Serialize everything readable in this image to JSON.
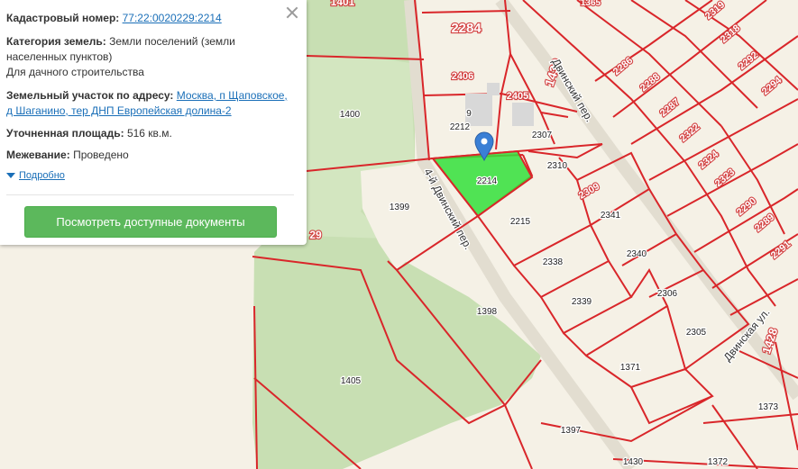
{
  "info_panel": {
    "cadastral_label": "Кадастровый номер:",
    "cadastral_value": "77:22:0020229:2214",
    "category_label": "Категория земель:",
    "category_value": "Земли поселений (земли",
    "category_value_2": "населенных пунктов)",
    "category_value_3": "Для дачного строительства",
    "address_label": "Земельный участок по адресу:",
    "address_value": "Москва, п Щаповское,",
    "address_value_2": "д Шаганино, тер ДНП Европейская долина-2",
    "area_label": "Уточненная площадь:",
    "area_value": "516 кв.м.",
    "survey_label": "Межевание:",
    "survey_value": "Проведено",
    "more_link": "Подробно",
    "docs_button": "Посмотреть доступные документы"
  },
  "map": {
    "highlight_color": "#33e03a",
    "boundary_color": "#d9262a",
    "forest_color": "#c7dfb0",
    "street_labels": {
      "a": "4-й Двинский пер.",
      "b": "Двинский пер.",
      "c": "Двинская ул."
    },
    "plots": {
      "p1401": "1401",
      "p1365": "1365",
      "p2284": "2284",
      "p2406": "2406",
      "p1400": "1400",
      "p2405": "2405",
      "p2212": "2212",
      "p9": "9",
      "p2307": "2307",
      "p1430a": "1430",
      "p2214": "2214",
      "p2310": "2310",
      "p2309": "2309",
      "p1399": "1399",
      "p2215": "2215",
      "p2341": "2341",
      "p2338": "2338",
      "p2340": "2340",
      "p2339": "2339",
      "p1398": "1398",
      "p2306": "2306",
      "p2305": "2305",
      "p1371": "1371",
      "p1405": "1405",
      "p1397": "1397",
      "p1430b": "1430",
      "p1372": "1372",
      "p1373": "1373",
      "p1428": "1428",
      "p2286": "2286",
      "p2319": "2319",
      "p2318": "2318",
      "p2288": "2288",
      "p2292": "2292",
      "p2287": "2287",
      "p2294": "2294",
      "p2322": "2322",
      "p2324": "2324",
      "p2323": "2323",
      "p2290": "2290",
      "p2289": "2289",
      "p2291": "2291",
      "p29": "29"
    }
  }
}
